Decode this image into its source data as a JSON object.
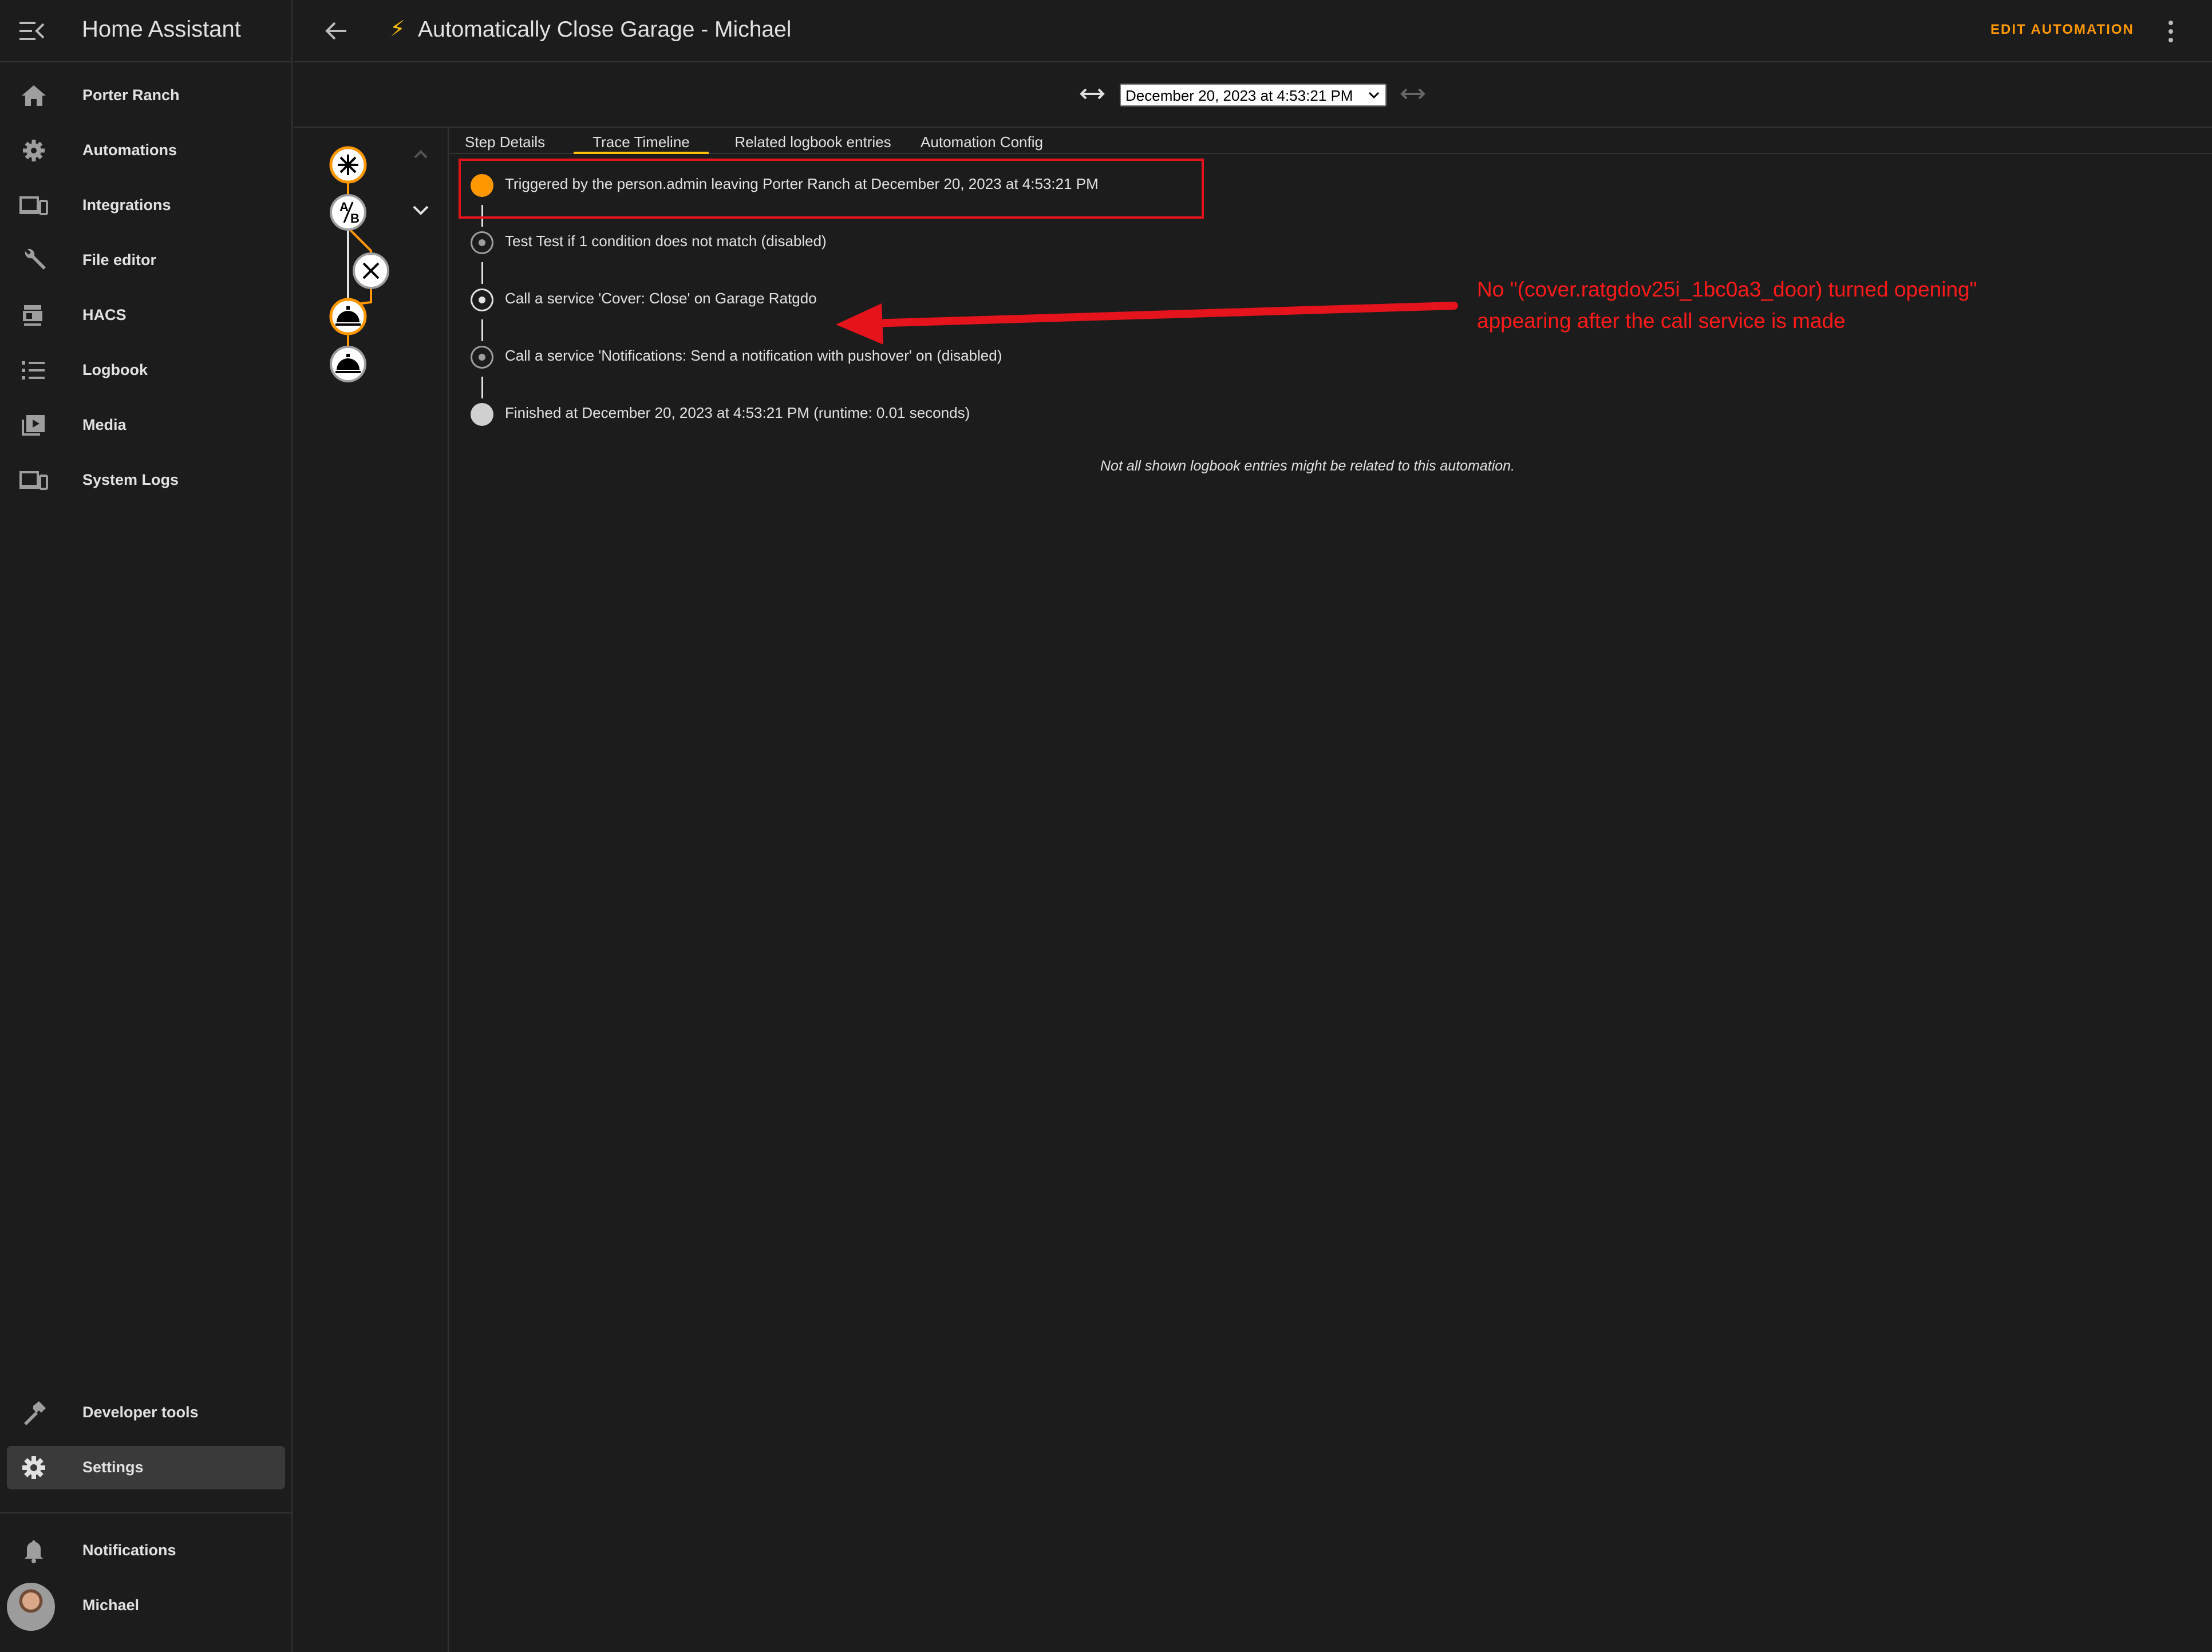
{
  "sidebar": {
    "app_title": "Home Assistant",
    "items": [
      {
        "label": "Porter Ranch",
        "icon": "home-icon"
      },
      {
        "label": "Automations",
        "icon": "robot-icon"
      },
      {
        "label": "Integrations",
        "icon": "devices-icon"
      },
      {
        "label": "File editor",
        "icon": "wrench-icon"
      },
      {
        "label": "HACS",
        "icon": "hacs-icon"
      },
      {
        "label": "Logbook",
        "icon": "list-icon"
      },
      {
        "label": "Media",
        "icon": "play-box-icon"
      },
      {
        "label": "System Logs",
        "icon": "devices-icon"
      }
    ],
    "developer_tools": "Developer tools",
    "settings": "Settings",
    "notifications": "Notifications",
    "user": "Michael"
  },
  "header": {
    "title": "Automatically Close Garage - Michael",
    "edit_label": "EDIT AUTOMATION"
  },
  "trace_selector": {
    "selected": "December 20, 2023 at 4:53:21 PM"
  },
  "tabs": [
    {
      "label": "Step Details",
      "active": false
    },
    {
      "label": "Trace Timeline",
      "active": true
    },
    {
      "label": "Related logbook entries",
      "active": false
    },
    {
      "label": "Automation Config",
      "active": false
    }
  ],
  "timeline": {
    "entries": [
      {
        "text": "Triggered by the person.admin leaving Porter Ranch at December 20, 2023 at 4:53:21 PM",
        "state": "trigger"
      },
      {
        "text": "Test Test if 1 condition does not match (disabled)",
        "state": "disabled"
      },
      {
        "text": "Call a service 'Cover: Close' on Garage Ratgdo",
        "state": "executed"
      },
      {
        "text": "Call a service 'Notifications: Send a notification with pushover' on (disabled)",
        "state": "disabled"
      },
      {
        "text": "Finished at December 20, 2023 at 4:53:21 PM (runtime: 0.01 seconds)",
        "state": "finished"
      }
    ],
    "note": "Not all shown logbook entries might be related to this automation."
  },
  "annotation": {
    "line1": "No \"(cover.ratgdov25i_1bc0a3_door) turned opening\"",
    "line2": "appearing after the call service is made",
    "color": "#ff1a1a"
  },
  "colors": {
    "accent": "#ff9800",
    "active_tab": "#ffc107",
    "background": "#1c1c1c"
  }
}
